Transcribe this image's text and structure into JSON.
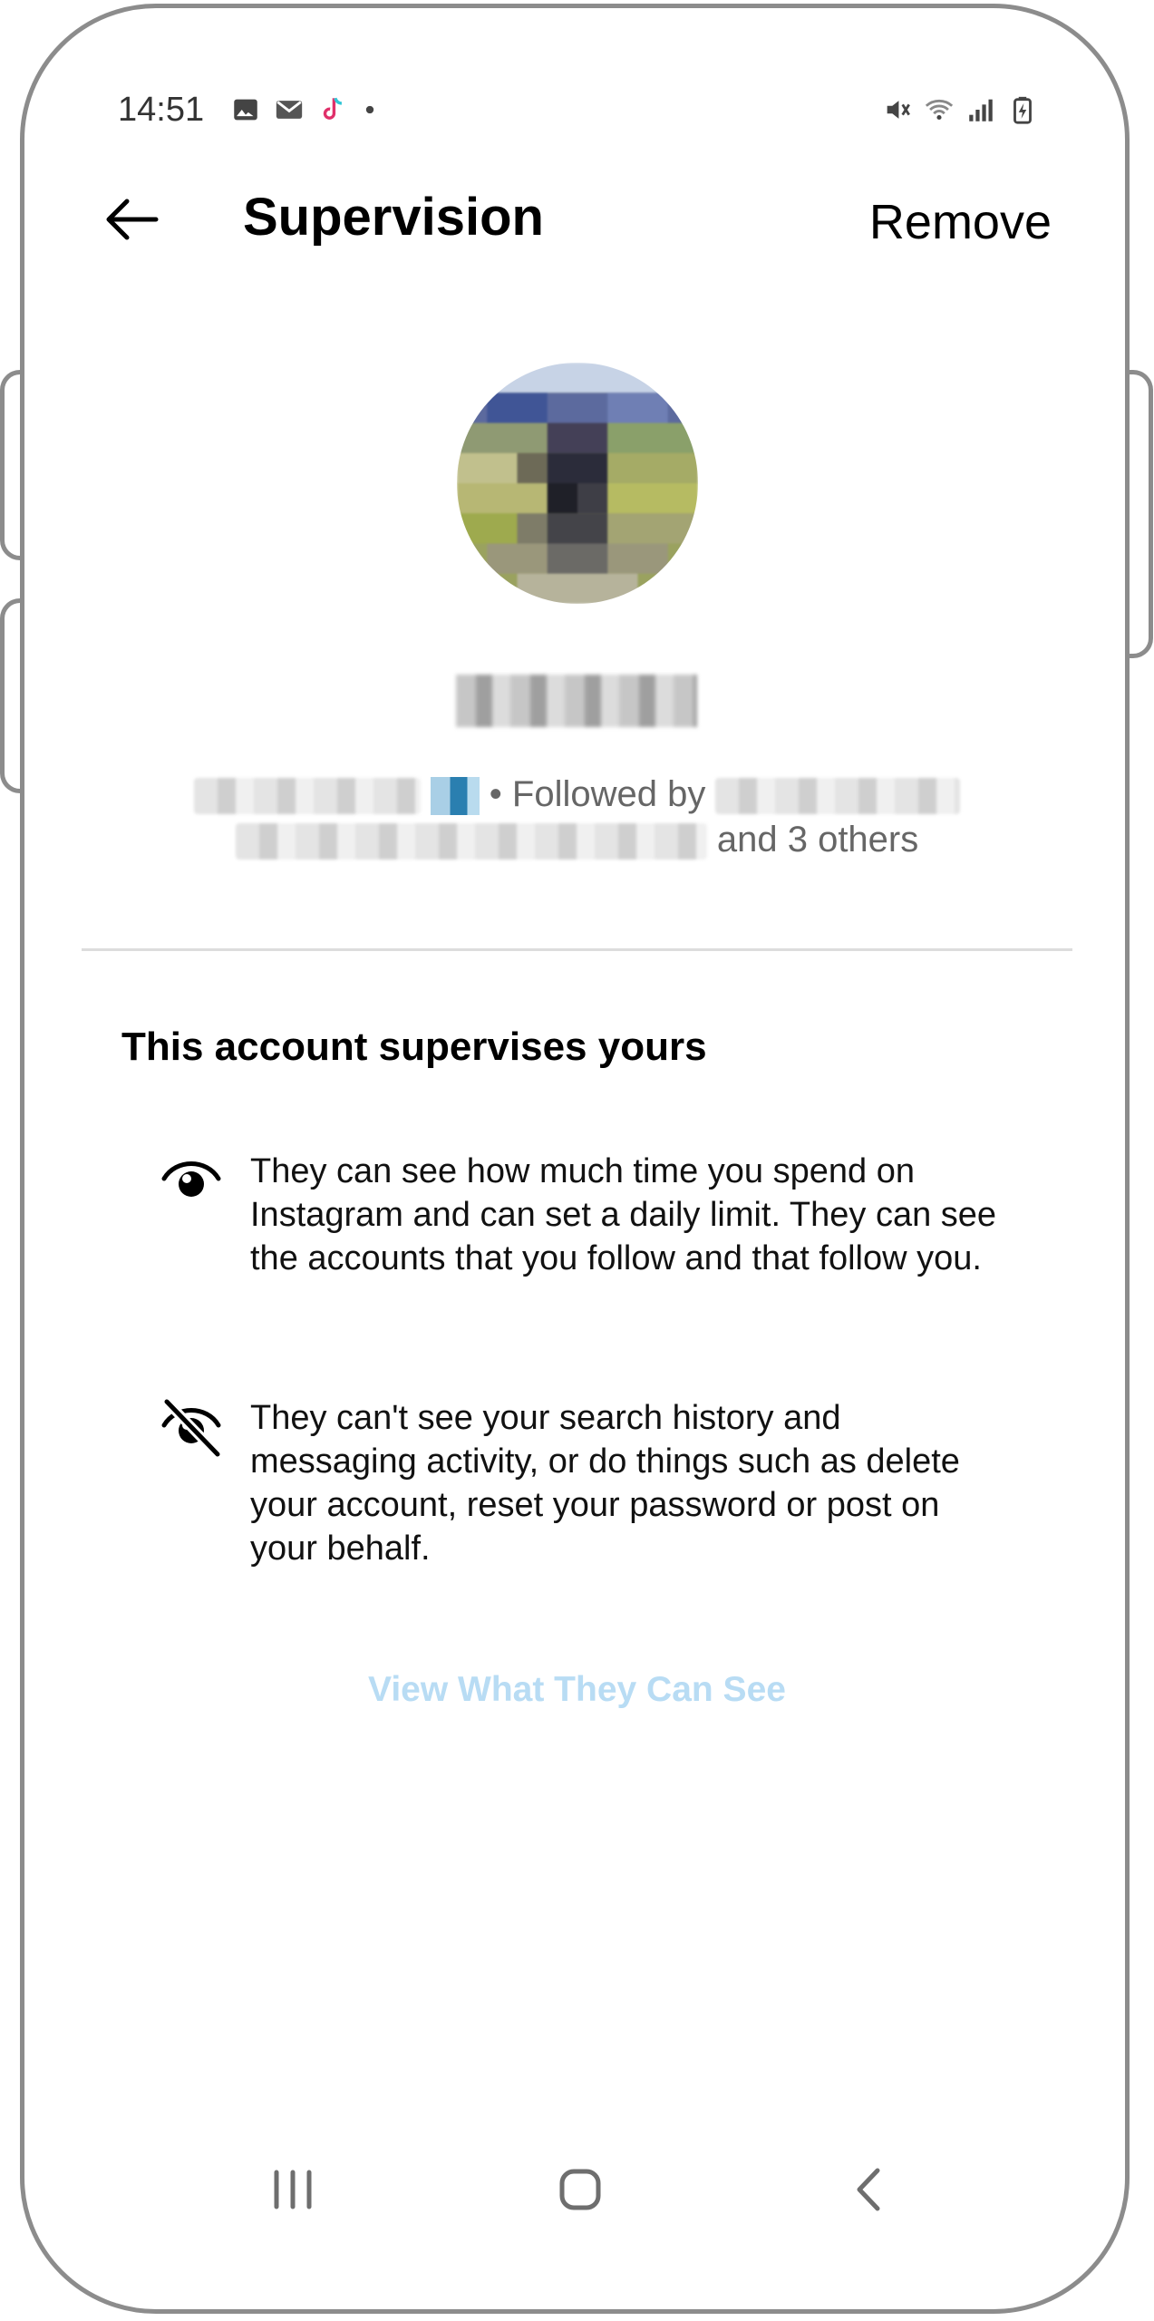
{
  "status_bar": {
    "time": "14:51",
    "left_icons": [
      "image-icon",
      "mail-icon",
      "tiktok-icon",
      "dot-icon"
    ],
    "right_icons": [
      "mute-icon",
      "wifi-icon",
      "signal-icon",
      "battery-charging-icon"
    ]
  },
  "header": {
    "title": "Supervision",
    "remove_label": "Remove"
  },
  "profile": {
    "followed_by_text": "• Followed by",
    "others_text": "and 3 others"
  },
  "supervision": {
    "section_title": "This account supervises yours",
    "can_see_text": "They can see how much time you spend on Instagram and can set a daily limit. They can see the accounts that you follow and that follow you.",
    "cant_see_text": "They can't see your search history and messaging activity, or do things such as delete your account, reset your password or post on your behalf.",
    "view_link": "View What They Can See"
  },
  "colors": {
    "link_disabled": "#b8dcf4",
    "divider": "#dcdcdc",
    "frame": "#8c8c8c"
  }
}
